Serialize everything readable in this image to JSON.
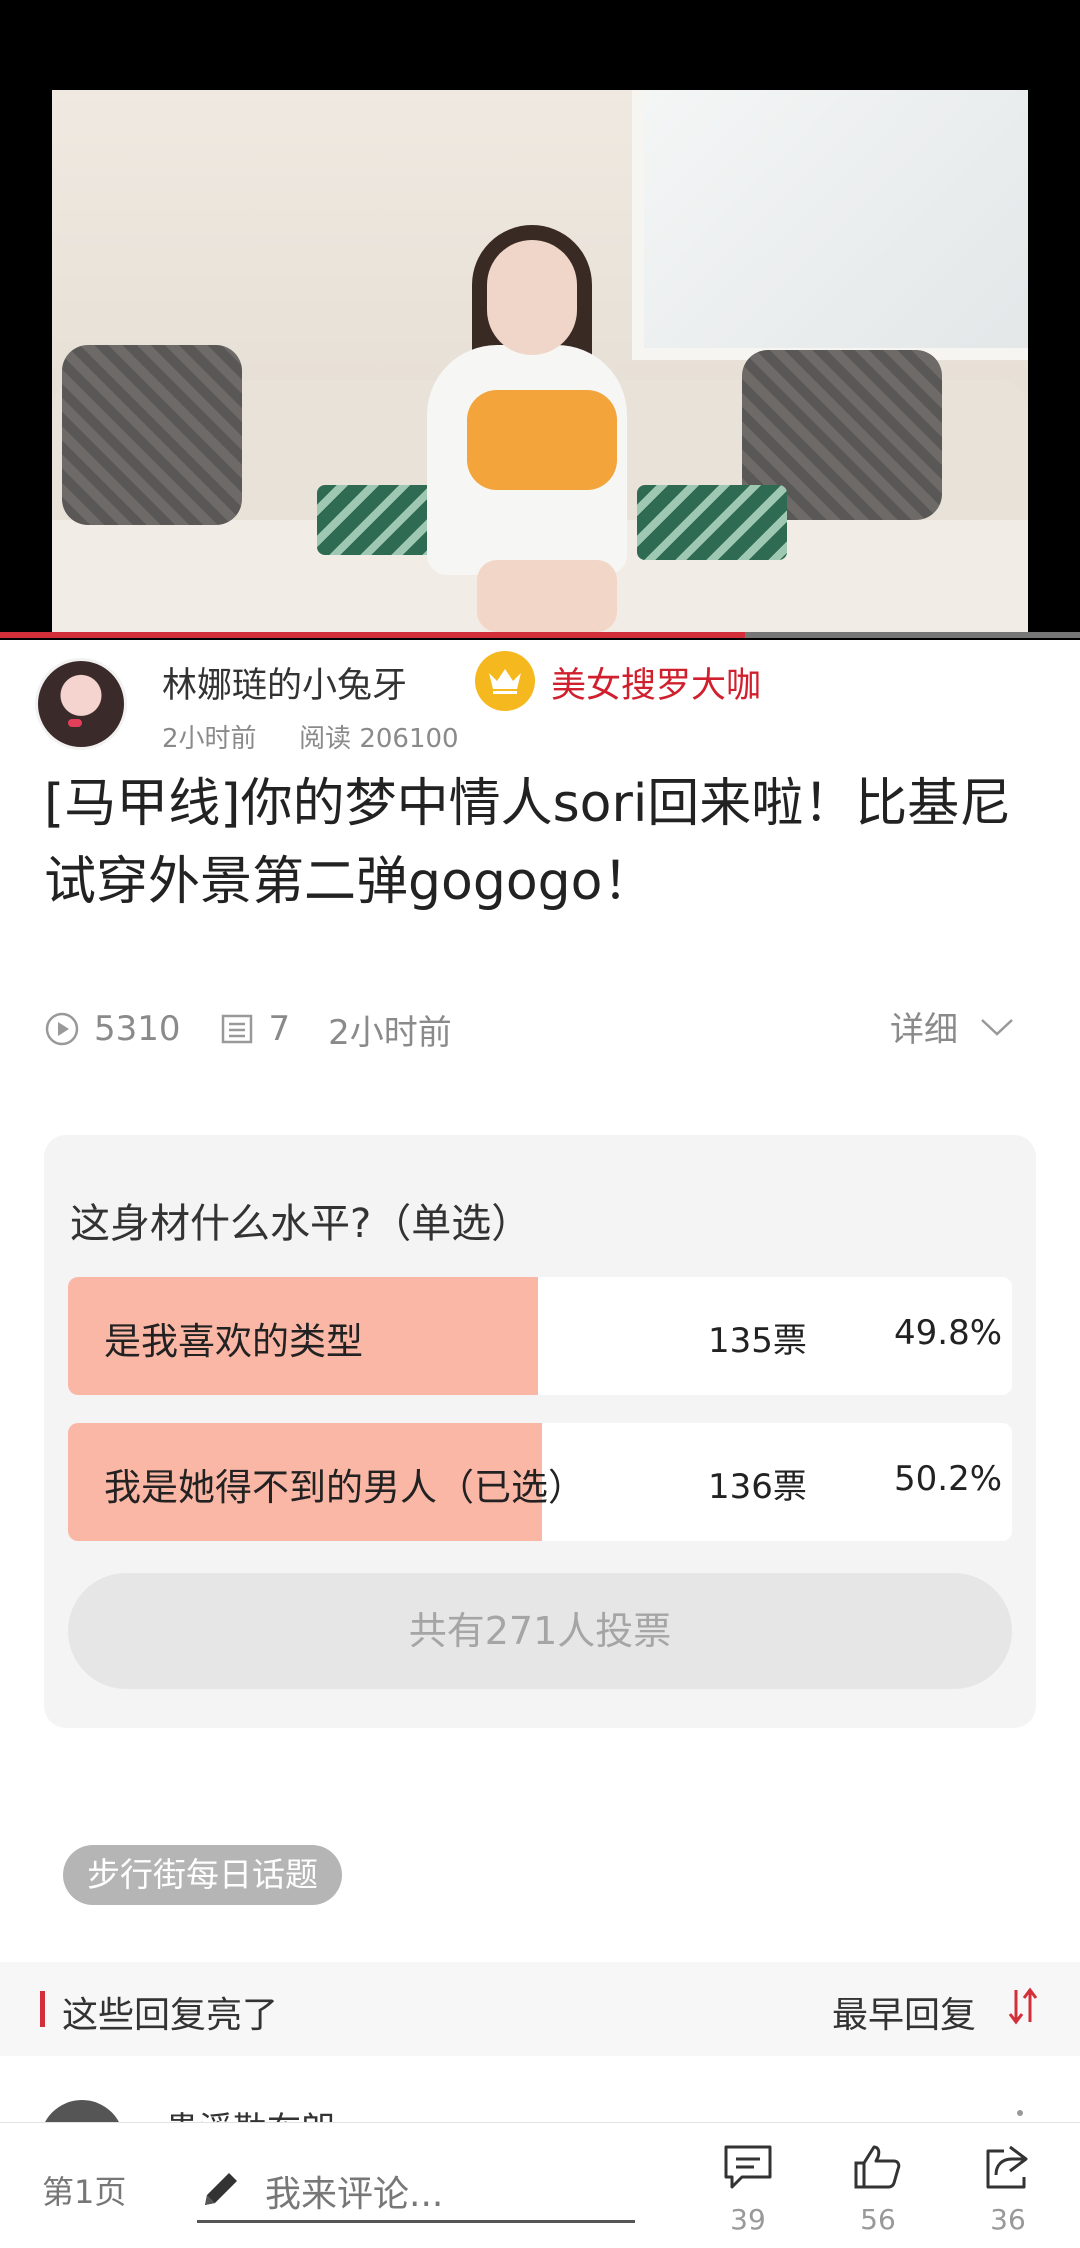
{
  "video": {
    "progress": 0.69
  },
  "author": {
    "name": "林娜琏的小兔牙",
    "badge": "美女搜罗大咖",
    "time": "2小时前",
    "reads": "阅读 206100"
  },
  "post": {
    "title": "[马甲线]你的梦中情人sori回来啦！比基尼试穿外景第二弹gogogo！",
    "views": "5310",
    "comments": "7",
    "time": "2小时前",
    "detail_label": "详细"
  },
  "poll": {
    "question": "这身材什么水平?（单选）",
    "options": [
      {
        "label": "是我喜欢的类型",
        "votes": "135票",
        "percent": "49.8%",
        "fraction": 0.498
      },
      {
        "label": "我是她得不到的男人（已选）",
        "votes": "136票",
        "percent": "50.2%",
        "fraction": 0.502
      }
    ],
    "total": "共有271人投票"
  },
  "topic": "步行街每日话题",
  "replies": {
    "title": "这些回复亮了",
    "sort_label": "最早回复",
    "first_name": "贵溪勒布朗"
  },
  "bottom": {
    "page": "第1页",
    "placeholder": "我来评论...",
    "comments": "39",
    "likes": "56",
    "shares": "36"
  },
  "colors": {
    "accent": "#d32f3a",
    "poll_fill": "#fbb7a6",
    "crown": "#f5b81e"
  }
}
